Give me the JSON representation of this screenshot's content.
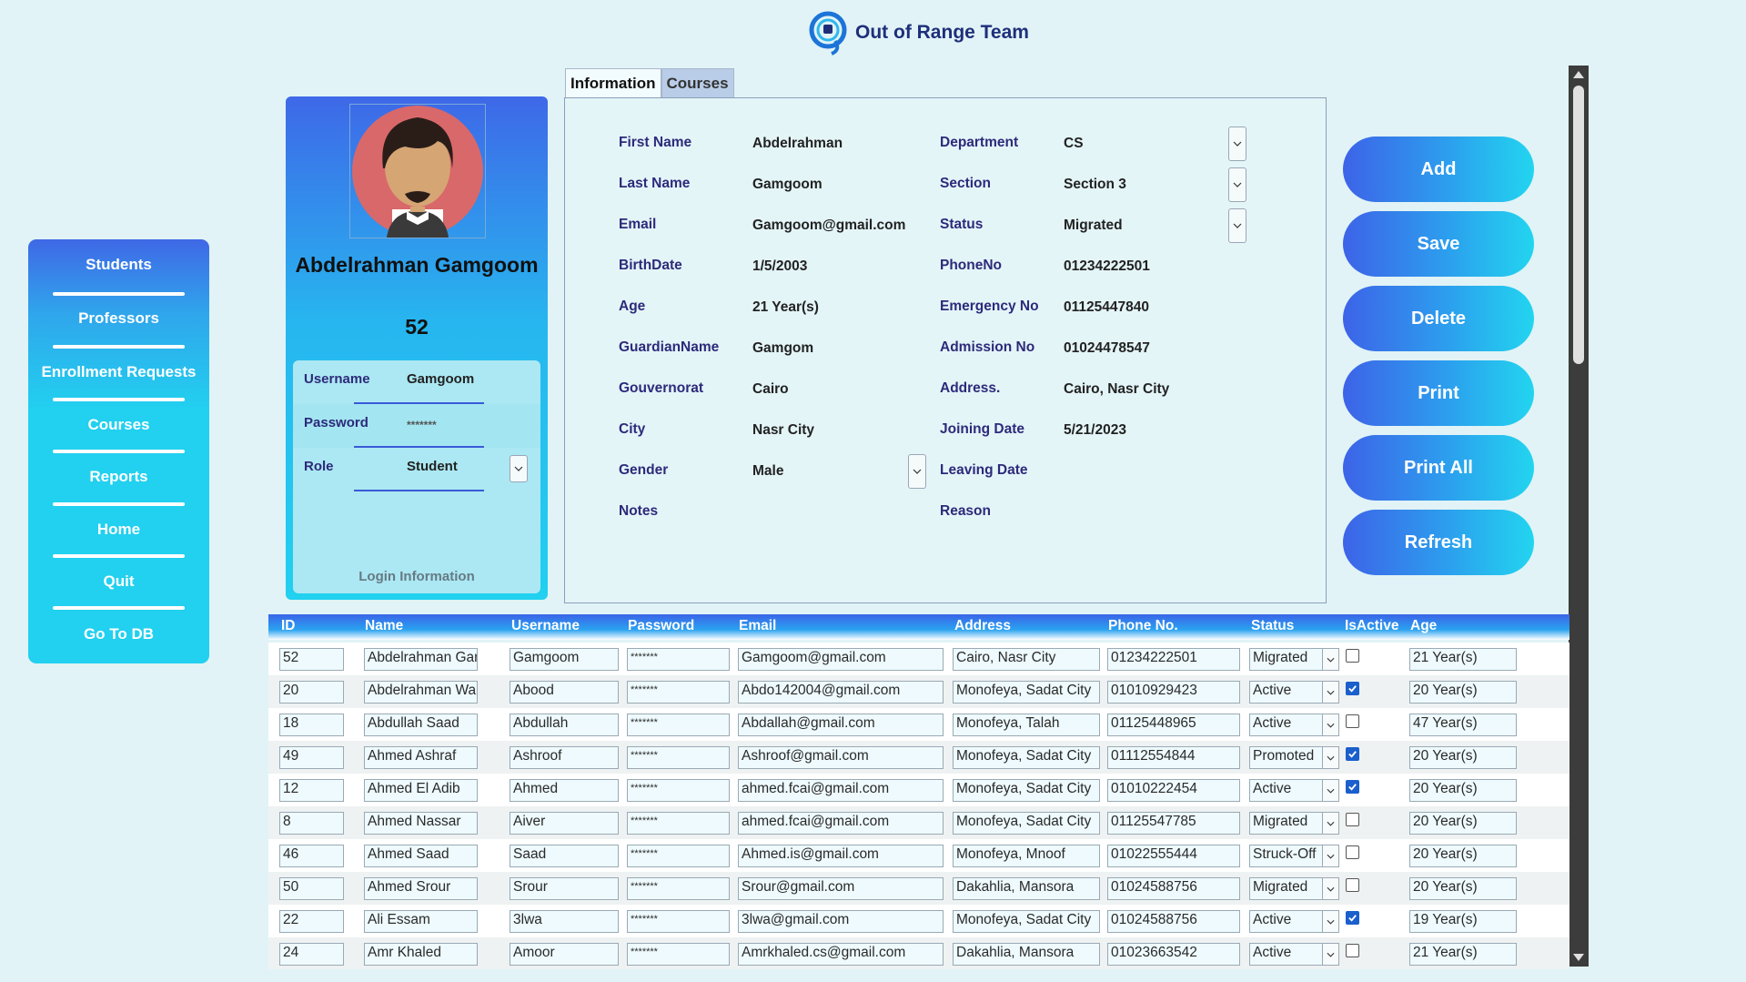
{
  "app": {
    "title": "Out of Range Team"
  },
  "sidebar": {
    "items": [
      "Students",
      "Professors",
      "Enrollment Requests",
      "Courses",
      "Reports",
      "Home",
      "Quit",
      "Go To DB"
    ]
  },
  "profile": {
    "name": "Abdelrahman Gamgoom",
    "id": "52",
    "login": {
      "username_label": "Username",
      "username": "Gamgoom",
      "password_label": "Password",
      "password": "*******",
      "role_label": "Role",
      "role": "Student",
      "title": "Login Information"
    }
  },
  "tabs": [
    "Information",
    "Courses"
  ],
  "info": {
    "first_name_label": "First Name",
    "first_name": "Abdelrahman",
    "last_name_label": "Last Name",
    "last_name": "Gamgoom",
    "email_label": "Email",
    "email": "Gamgoom@gmail.com",
    "birthdate_label": "BirthDate",
    "birthdate": "1/5/2003",
    "age_label": "Age",
    "age": "21 Year(s)",
    "guardian_label": "GuardianName",
    "guardian": "Gamgom",
    "gouvernorat_label": "Gouvernorat",
    "gouvernorat": "Cairo",
    "city_label": "City",
    "city": "Nasr City",
    "gender_label": "Gender",
    "gender": "Male",
    "notes_label": "Notes",
    "department_label": "Department",
    "department": "CS",
    "section_label": "Section",
    "section": "Section 3",
    "status_label": "Status",
    "status": "Migrated",
    "phone_label": "PhoneNo",
    "phone": "01234222501",
    "emergency_label": "Emergency No",
    "emergency": "01125447840",
    "admission_label": "Admission No",
    "admission": "01024478547",
    "address_label": "Address.",
    "address": "Cairo, Nasr City",
    "joining_label": "Joining Date",
    "joining": "5/21/2023",
    "leaving_label": "Leaving Date",
    "reason_label": "Reason"
  },
  "actions": [
    "Add",
    "Save",
    "Delete",
    "Print",
    "Print All",
    "Refresh"
  ],
  "table": {
    "columns": [
      "ID",
      "Name",
      "Username",
      "Password",
      "Email",
      "Address",
      "Phone No.",
      "Status",
      "IsActive",
      "Age"
    ],
    "rows": [
      {
        "id": "52",
        "name": "Abdelrahman Gamgoom",
        "username": "Gamgoom",
        "password": "*******",
        "email": "Gamgoom@gmail.com",
        "address": "Cairo, Nasr City",
        "phone": "01234222501",
        "status": "Migrated",
        "active": false,
        "age": "21 Year(s)"
      },
      {
        "id": "20",
        "name": "Abdelrahman Waleed",
        "username": "Abood",
        "password": "*******",
        "email": "Abdo142004@gmail.com",
        "address": "Monofeya, Sadat City",
        "phone": "01010929423",
        "status": "Active",
        "active": true,
        "age": "20 Year(s)"
      },
      {
        "id": "18",
        "name": "Abdullah Saad",
        "username": "Abdullah",
        "password": "*******",
        "email": "Abdallah@gmail.com",
        "address": "Monofeya, Talah",
        "phone": "01125448965",
        "status": "Active",
        "active": false,
        "age": "47 Year(s)"
      },
      {
        "id": "49",
        "name": "Ahmed Ashraf",
        "username": "Ashroof",
        "password": "*******",
        "email": "Ashroof@gmail.com",
        "address": "Monofeya, Sadat City",
        "phone": "01112554844",
        "status": "Promoted",
        "active": true,
        "age": "20 Year(s)"
      },
      {
        "id": "12",
        "name": "Ahmed El Adib",
        "username": "Ahmed",
        "password": "*******",
        "email": "ahmed.fcai@gmail.com",
        "address": "Monofeya, Sadat City",
        "phone": "01010222454",
        "status": "Active",
        "active": true,
        "age": "20 Year(s)"
      },
      {
        "id": "8",
        "name": "Ahmed Nassar",
        "username": "Aiver",
        "password": "*******",
        "email": "ahmed.fcai@gmail.com",
        "address": "Monofeya, Sadat City",
        "phone": "01125547785",
        "status": "Migrated",
        "active": false,
        "age": "20 Year(s)"
      },
      {
        "id": "46",
        "name": "Ahmed Saad",
        "username": "Saad",
        "password": "*******",
        "email": "Ahmed.is@gmail.com",
        "address": "Monofeya, Mnoof",
        "phone": "01022555444",
        "status": "Struck-Off",
        "active": false,
        "age": "20 Year(s)"
      },
      {
        "id": "50",
        "name": "Ahmed Srour",
        "username": "Srour",
        "password": "*******",
        "email": "Srour@gmail.com",
        "address": "Dakahlia, Mansora",
        "phone": "01024588756",
        "status": "Migrated",
        "active": false,
        "age": "20 Year(s)"
      },
      {
        "id": "22",
        "name": "Ali Essam",
        "username": "3lwa",
        "password": "*******",
        "email": "3lwa@gmail.com",
        "address": "Monofeya, Sadat City",
        "phone": "01024588756",
        "status": "Active",
        "active": true,
        "age": "19 Year(s)"
      },
      {
        "id": "24",
        "name": "Amr Khaled",
        "username": "Amoor",
        "password": "*******",
        "email": "Amrkhaled.cs@gmail.com",
        "address": "Dakahlia, Mansora",
        "phone": "01023663542",
        "status": "Active",
        "active": false,
        "age": "21 Year(s)"
      }
    ]
  },
  "colors": {
    "accent_blue": "#3d63e8",
    "accent_cyan": "#22d5ef",
    "background": "#e1f3f6"
  }
}
